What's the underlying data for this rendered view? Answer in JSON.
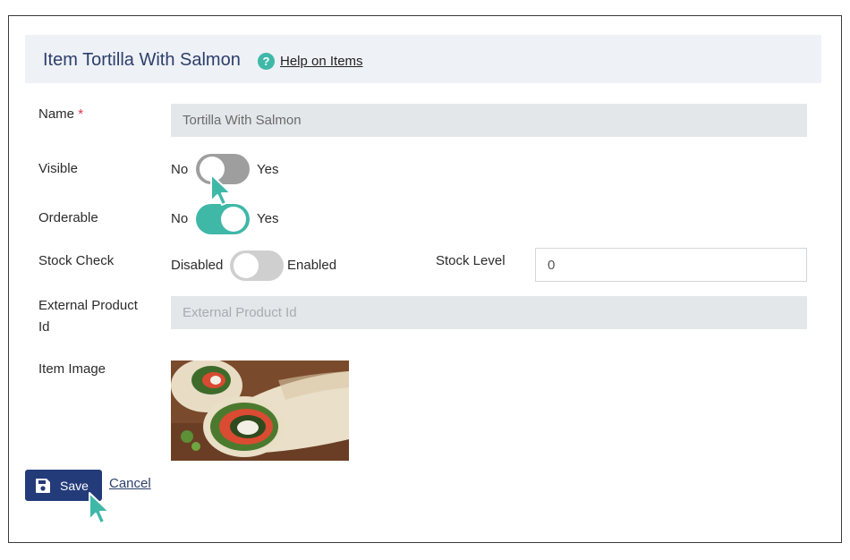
{
  "header": {
    "title": "Item Tortilla With Salmon",
    "help_icon": "question-circle-icon",
    "help_label": "Help on Items"
  },
  "form": {
    "name": {
      "label": "Name",
      "required_mark": "*",
      "value": "Tortilla With Salmon"
    },
    "visible": {
      "label": "Visible",
      "off_label": "No",
      "on_label": "Yes",
      "state": "off"
    },
    "orderable": {
      "label": "Orderable",
      "off_label": "No",
      "on_label": "Yes",
      "state": "on"
    },
    "stock_check": {
      "label": "Stock Check",
      "off_label": "Disabled",
      "on_label": "Enabled",
      "state": "off"
    },
    "stock_level": {
      "label": "Stock Level",
      "value": "0"
    },
    "external_product_id": {
      "label_line1": "External Product",
      "label_line2": "Id",
      "placeholder": "External Product Id"
    },
    "item_image": {
      "label": "Item Image"
    }
  },
  "actions": {
    "save_label": "Save",
    "save_icon": "floppy-disk-icon",
    "cancel_label": "Cancel"
  },
  "colors": {
    "accent": "#3fb8a8",
    "primary": "#243b7a",
    "required": "#e0344a"
  }
}
